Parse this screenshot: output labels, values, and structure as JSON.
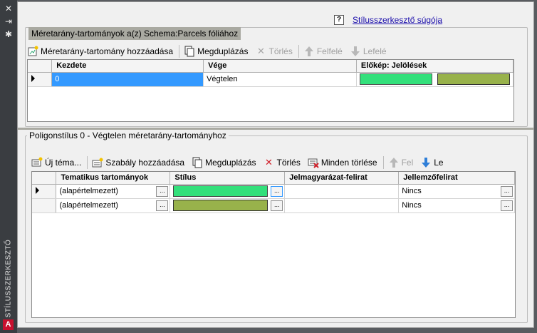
{
  "window": {
    "vertical_title": "STÍLUSSZERKESZTŐ",
    "logo_letter": "A",
    "controls": [
      "✕",
      "⇥",
      "✱"
    ]
  },
  "help": {
    "icon": "?",
    "link_label": "Stílusszerkesztő súgója"
  },
  "scale_ranges": {
    "title": "Méretarány-tartományok a(z) Schema:Parcels fóliához",
    "toolbar": {
      "add": "Méretarány-tartomány hozzáadása",
      "duplicate": "Megduplázás",
      "delete": "Törlés",
      "up": "Felfelé",
      "down": "Lefelé"
    },
    "columns": [
      "Kezdete",
      "Vége",
      "Előkép: Jelölések"
    ],
    "rows": [
      {
        "start": "0",
        "end": "Végtelen",
        "preview_colors": [
          "#33e07b",
          "#98b24b"
        ]
      }
    ]
  },
  "polygon_style": {
    "title": "Poligonstílus 0 - Végtelen méretarány-tartományhoz",
    "toolbar": {
      "new_theme": "Új téma...",
      "add_rule": "Szabály hozzáadása",
      "duplicate": "Megduplázás",
      "delete": "Törlés",
      "delete_all": "Minden törlése",
      "up": "Fel",
      "down": "Le"
    },
    "columns": [
      "Tematikus tartományok",
      "Stílus",
      "Jelmagyarázat-felirat",
      "Jellemzőfelirat"
    ],
    "ellipsis": "...",
    "rows": [
      {
        "theme": "(alapértelmezett)",
        "style_color": "#33e07b",
        "legend": "",
        "feature_label": "Nincs"
      },
      {
        "theme": "(alapértelmezett)",
        "style_color": "#98b24b",
        "legend": "",
        "feature_label": "Nincs"
      }
    ]
  }
}
